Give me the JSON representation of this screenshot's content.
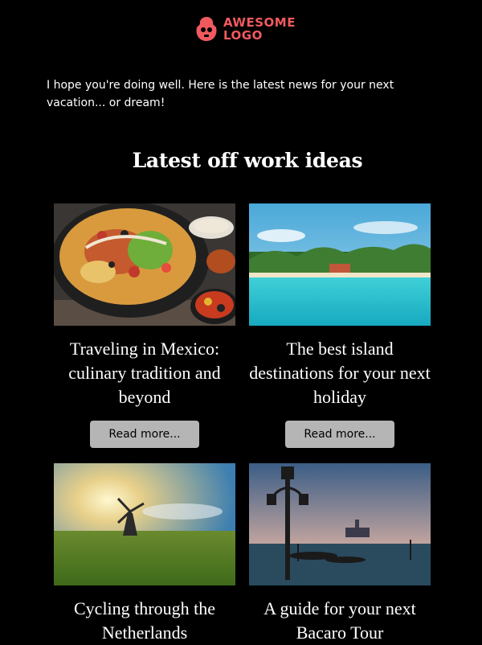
{
  "logo": {
    "text": "AWESOME\nLOGO",
    "color": "#f05a5f"
  },
  "intro": "I hope you're doing well. Here is the latest news for your next vacation... or dream!",
  "section_title": "Latest off work ideas",
  "cards": [
    {
      "title": "Traveling in Mexico: culinary tradition and beyond",
      "button": "Read more...",
      "image": "nachos-plate"
    },
    {
      "title": "The best island destinations for your next holiday",
      "button": "Read more...",
      "image": "tropical-beach"
    },
    {
      "title": "Cycling through the Netherlands",
      "image": "windmill-field"
    },
    {
      "title": "A guide for your next Bacaro Tour",
      "image": "venice-gondolas"
    }
  ]
}
